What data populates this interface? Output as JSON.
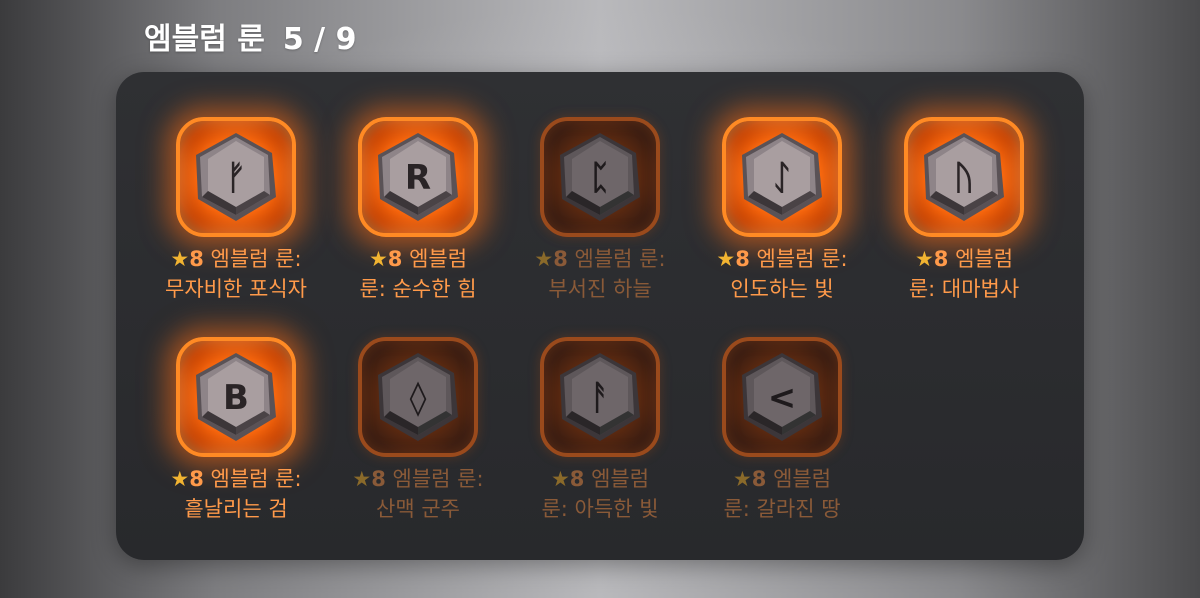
{
  "header": {
    "title": "엠블럼 룬",
    "count": "5 / 9"
  },
  "colors": {
    "active_text": "#ff9a4a",
    "inactive_text": "#8a5a38",
    "active_star": "#f2b431",
    "inactive_star": "#8a6a2a",
    "active_glow": "#ff6d10"
  },
  "runes": [
    {
      "star": "★",
      "grade": "8",
      "line1": " 엠블럼 룬:",
      "line2": "무자비한 포식자",
      "glyph": "ᚠ",
      "active": true
    },
    {
      "star": "★",
      "grade": "8",
      "line1": " 엠블럼",
      "line2": "룬: 순수한 힘",
      "glyph": "R",
      "active": true
    },
    {
      "star": "★",
      "grade": "8",
      "line1": " 엠블럼 룬:",
      "line2": "부서진 하늘",
      "glyph": "ᛈ",
      "active": false
    },
    {
      "star": "★",
      "grade": "8",
      "line1": " 엠블럼 룬:",
      "line2": "인도하는 빛",
      "glyph": "ᛇ",
      "active": true
    },
    {
      "star": "★",
      "grade": "8",
      "line1": " 엠블럼",
      "line2": "룬: 대마법사",
      "glyph": "ᚢ",
      "active": true
    },
    {
      "star": "★",
      "grade": "8",
      "line1": " 엠블럼 룬:",
      "line2": "흩날리는 검",
      "glyph": "B",
      "active": true
    },
    {
      "star": "★",
      "grade": "8",
      "line1": " 엠블럼 룬:",
      "line2": "산맥 군주",
      "glyph": "◊",
      "active": false
    },
    {
      "star": "★",
      "grade": "8",
      "line1": " 엠블럼",
      "line2": "룬: 아득한 빛",
      "glyph": "ᚨ",
      "active": false
    },
    {
      "star": "★",
      "grade": "8",
      "line1": " 엠블럼",
      "line2": "룬: 갈라진 땅",
      "glyph": "<",
      "active": false
    }
  ]
}
